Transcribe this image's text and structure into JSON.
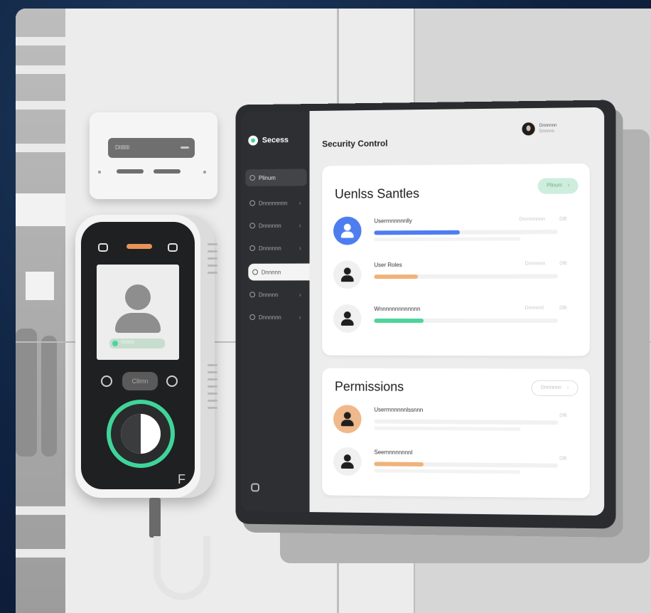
{
  "device": {
    "wall_reader_label": "Dllllllll",
    "verify_label": "llllllllllllll",
    "center_button": "Cllmn",
    "logo_glyph": "F"
  },
  "app": {
    "brand": "Secess",
    "title": "Security Control",
    "user": {
      "name": "Dnnnnnn",
      "subtitle": "Dnnnnn"
    }
  },
  "sidebar": {
    "items": [
      {
        "label": "Plinum"
      },
      {
        "label": "Dnnnnnnnn"
      },
      {
        "label": "Dnnnnnn"
      },
      {
        "label": "Dnnnnnn"
      },
      {
        "label": "Dnnnnn"
      },
      {
        "label": "Dnnnnn"
      },
      {
        "label": "Dnnnnnn"
      }
    ]
  },
  "users_card": {
    "heading": "Uenlss Santles",
    "action": "Plinum",
    "rows": [
      {
        "label": "Userrnnnnnnlly",
        "meta1": "Dnnnnnnnn",
        "meta2": "Dllt",
        "progress": 0.47,
        "color": "#4e7df0"
      },
      {
        "label": "User Roles",
        "meta1": "Dnnnnnn",
        "meta2": "Dllt",
        "progress": 0.24,
        "color": "#f0b27a"
      },
      {
        "label": "Wnnnnnnnnnnnnn",
        "meta1": "Dnnnnnl",
        "meta2": "Dllt",
        "progress": 0.27,
        "color": "#4fd39a"
      }
    ]
  },
  "permissions_card": {
    "heading": "Permissions",
    "action": "Dnnnnnn",
    "rows": [
      {
        "label": "Userrnnnnnnlssnnn",
        "meta2": "Dllt",
        "progress": 0,
        "color": "#f0b27a"
      },
      {
        "label": "Seernnnnnnnnl",
        "meta2": "Dllt",
        "progress": 0.27,
        "color": "#f0b27a"
      }
    ]
  },
  "icons": {
    "chevron": "›",
    "arrow": "→"
  }
}
